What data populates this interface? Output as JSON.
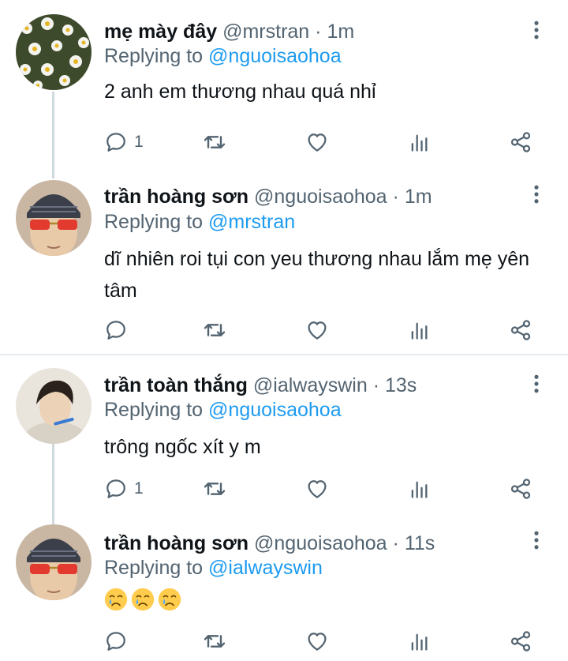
{
  "tweets": [
    {
      "name": "mẹ mày đây",
      "handle": "@mrstran",
      "separator": "·",
      "time": "1m",
      "replying_prefix": "Replying to",
      "replying_to": "@nguoisaohoa",
      "text": "2 anh em thương nhau quá nhỉ",
      "reply_count": "1",
      "avatar": "daisy-flowers-avatar"
    },
    {
      "name": "trần hoàng sơn",
      "handle": "@nguoisaohoa",
      "separator": "·",
      "time": "1m",
      "replying_prefix": "Replying to",
      "replying_to": "@mrstran",
      "text": "dĩ nhiên roi tụi con yeu thương nhau lắm mẹ yên tâm",
      "reply_count": "",
      "avatar": "beanie-sunglasses-avatar"
    },
    {
      "name": "trần toàn thắng",
      "handle": "@ialwayswin",
      "separator": "·",
      "time": "13s",
      "replying_prefix": "Replying to",
      "replying_to": "@nguoisaohoa",
      "text": "trông ngốc xít y m",
      "reply_count": "1",
      "avatar": "person-photo-avatar"
    },
    {
      "name": "trần hoàng sơn",
      "handle": "@nguoisaohoa",
      "separator": "·",
      "time": "11s",
      "replying_prefix": "Replying to",
      "replying_to": "@ialwayswin",
      "emojis": [
        "crying-face-emoji",
        "crying-face-emoji",
        "crying-face-emoji"
      ],
      "reply_count": "",
      "avatar": "beanie-sunglasses-avatar"
    }
  ],
  "icons": {
    "reply": "reply-icon",
    "retweet": "retweet-icon",
    "like": "heart-icon",
    "views": "analytics-icon",
    "share": "share-icon",
    "more": "more-vertical-icon"
  },
  "colors": {
    "text": "#0f1419",
    "secondary": "#536471",
    "mention": "#1d9bf0",
    "thread_line": "#cfd9de"
  }
}
